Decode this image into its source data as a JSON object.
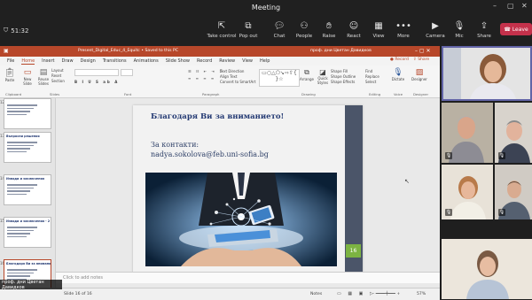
{
  "window": {
    "title": "Meeting",
    "timer": "51:32"
  },
  "toolbar": {
    "take_control": "Take control",
    "pop_out": "Pop out",
    "chat": "Chat",
    "people": "People",
    "raise": "Raise",
    "react": "React",
    "view": "View",
    "more": "More",
    "camera": "Camera",
    "mic": "Mic",
    "share": "Share",
    "leave": "Leave"
  },
  "ppt": {
    "filename": "Present_Digital_Educ_4_Equitc • Saved to this PC",
    "user": "проф. дни Цветан Давидков",
    "tabs": [
      "File",
      "Home",
      "Insert",
      "Draw",
      "Design",
      "Transitions",
      "Animations",
      "Slide Show",
      "Record",
      "Review",
      "View",
      "Help"
    ],
    "record_btn": "Record",
    "share_btn": "Share",
    "groups": {
      "clipboard": "Clipboard",
      "slides": "Slides",
      "font": "Font",
      "paragraph": "Paragraph",
      "drawing": "Drawing",
      "editing": "Editing",
      "voice": "Voice",
      "designer": "Designer"
    },
    "ribbon": {
      "paste": "Paste",
      "new_slide": "New Slide",
      "reuse": "Reuse Slides",
      "layout": "Layout",
      "reset": "Reset",
      "section": "Section",
      "arrange": "Arrange",
      "quick_styles": "Quick Styles",
      "find": "Find",
      "replace": "Replace",
      "select": "Select",
      "dictate": "Dictate",
      "designer": "Designer",
      "shape_fill": "Shape Fill",
      "shape_outline": "Shape Outline",
      "shape_effects": "Shape Effects",
      "text_direction": "Text Direction",
      "align_text": "Align Text",
      "convert_smartart": "Convert to SmartArt"
    },
    "notes_placeholder": "Click to add notes",
    "status_left": "Slide 16 of 16",
    "status_right_notes": "Notes",
    "zoom": "57%"
  },
  "slide": {
    "title": "Благодаря Ви за вниманието!",
    "contact_label": "За контакти:",
    "email": "nadya.sokolova@feb.uni-sofia.bg",
    "number": "16"
  },
  "thumbs": [
    {
      "num": "12",
      "title": ""
    },
    {
      "num": "13",
      "title": "Въпросни решения"
    },
    {
      "num": "14",
      "title": "Изводи и заключения"
    },
    {
      "num": "15",
      "title": "Изводи и заключения - 2"
    },
    {
      "num": "16",
      "title": "Благодаря Ви за вниманието!"
    }
  ],
  "presenter_label": "проф. дни Цветан Давидков",
  "colors": {
    "teams_bg": "#202020",
    "ppt_red": "#b7472a",
    "leave_red": "#c4314b",
    "slide_bar": "#4b5569",
    "slide_num_green": "#7cb342",
    "active_tile_border": "#6264a7"
  }
}
